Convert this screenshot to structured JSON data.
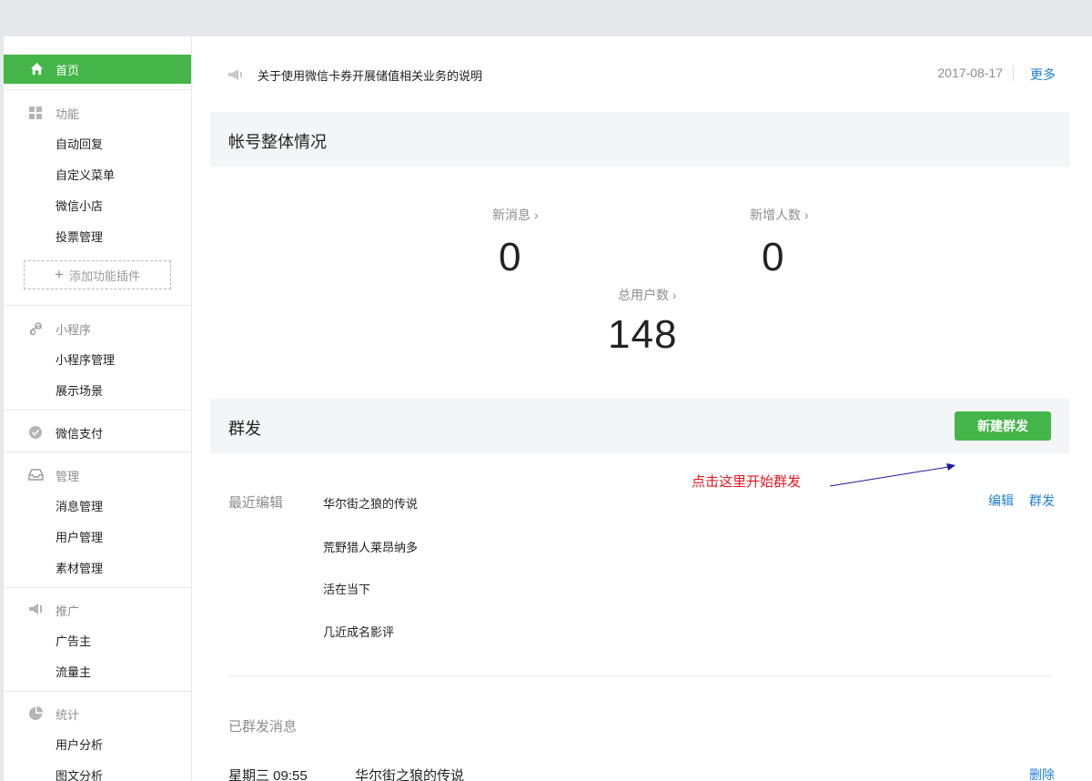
{
  "sidebar": {
    "home": {
      "label": "首页",
      "icon": "home-icon"
    },
    "sections": [
      {
        "label": "功能",
        "icon": "grid-icon",
        "items": [
          "自动回复",
          "自定义菜单",
          "微信小店",
          "投票管理"
        ],
        "add_plugin": "添加功能插件"
      },
      {
        "label": "小程序",
        "icon": "miniprogram-icon",
        "items": [
          "小程序管理",
          "展示场景"
        ]
      },
      {
        "label": "微信支付",
        "icon": "wechat-pay-icon",
        "items": []
      },
      {
        "label": "管理",
        "icon": "inbox-icon",
        "items": [
          "消息管理",
          "用户管理",
          "素材管理"
        ]
      },
      {
        "label": "推广",
        "icon": "megaphone-icon",
        "items": [
          "广告主",
          "流量主"
        ]
      },
      {
        "label": "统计",
        "icon": "pie-chart-icon",
        "items": [
          "用户分析",
          "图文分析"
        ]
      }
    ]
  },
  "notice": {
    "text": "关于使用微信卡券开展储值相关业务的说明",
    "date": "2017-08-17",
    "more": "更多"
  },
  "overview": {
    "title": "帐号整体情况",
    "new_messages": {
      "label": "新消息 ›",
      "value": "0"
    },
    "new_followers": {
      "label": "新增人数 ›",
      "value": "0"
    },
    "total_users": {
      "label": "总用户数 ›",
      "value": "148"
    }
  },
  "broadcast": {
    "title": "群发",
    "new_button": "新建群发",
    "annotation": "点击这里开始群发",
    "recent_label": "最近编辑",
    "drafts": [
      "华尔街之狼的传说",
      "荒野猎人莱昂纳多",
      "活在当下",
      "几近成名影评"
    ],
    "edit": "编辑",
    "send": "群发",
    "sent_label": "已群发消息",
    "sent": [
      {
        "time": "星期三 09:55",
        "title": "华尔街之狼的传说",
        "action": "删除"
      }
    ]
  },
  "colors": {
    "accent_green": "#44b549",
    "link_blue": "#1e7fd8",
    "annotation_red": "#e8151c"
  }
}
